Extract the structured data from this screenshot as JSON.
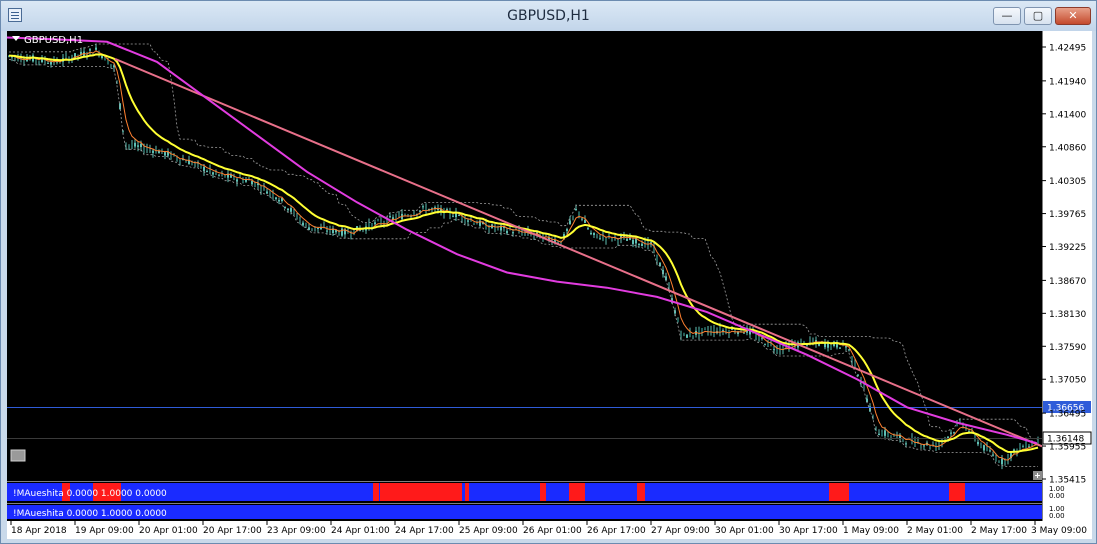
{
  "window": {
    "title": "GBPUSD,H1",
    "minimize_glyph": "—",
    "maximize_glyph": "▢",
    "close_glyph": "✕"
  },
  "chart": {
    "symbol_label": "GBPUSD,H1",
    "current_price_label": "1.36656",
    "bid_price_label": "1.36148",
    "price_ticks": [
      "1.42495",
      "1.41940",
      "1.41400",
      "1.40860",
      "1.40305",
      "1.39765",
      "1.39225",
      "1.38670",
      "1.38130",
      "1.37590",
      "1.37050",
      "1.36495",
      "1.35955",
      "1.35415"
    ],
    "time_ticks": [
      "18 Apr 2018",
      "19 Apr 09:00",
      "20 Apr 01:00",
      "20 Apr 17:00",
      "23 Apr 09:00",
      "24 Apr 01:00",
      "24 Apr 17:00",
      "25 Apr 09:00",
      "26 Apr 01:00",
      "26 Apr 17:00",
      "27 Apr 09:00",
      "30 Apr 01:00",
      "30 Apr 17:00",
      "1 May 09:00",
      "2 May 01:00",
      "2 May 17:00",
      "3 May 09:00"
    ]
  },
  "indicators": [
    {
      "label": "!MAueshita 0.0000 1.0000 0.0000",
      "scale_top": "1.00",
      "scale_bottom": "0.00"
    },
    {
      "label": "!MAueshita 0.0000 1.0000 0.0000",
      "scale_top": "1.00",
      "scale_bottom": "0.00"
    }
  ],
  "colors": {
    "background": "#000000",
    "axis_panel": "#ffffff",
    "grid_text": "#000000",
    "bull_candle": "#5fbfb3",
    "yellow_ma": "#ffff33",
    "magenta_ma": "#e23ce0",
    "trend_line": "#e8708a",
    "fast_ma": "#ff8030",
    "indicator_blue": "#1a2bff",
    "indicator_red": "#ff1a1a",
    "price_tag": "#2f5cd9"
  },
  "icons": {
    "dropdown": "triangle-down-icon",
    "scroll_box": "scroll-box-icon",
    "plus": "plus-icon"
  }
}
